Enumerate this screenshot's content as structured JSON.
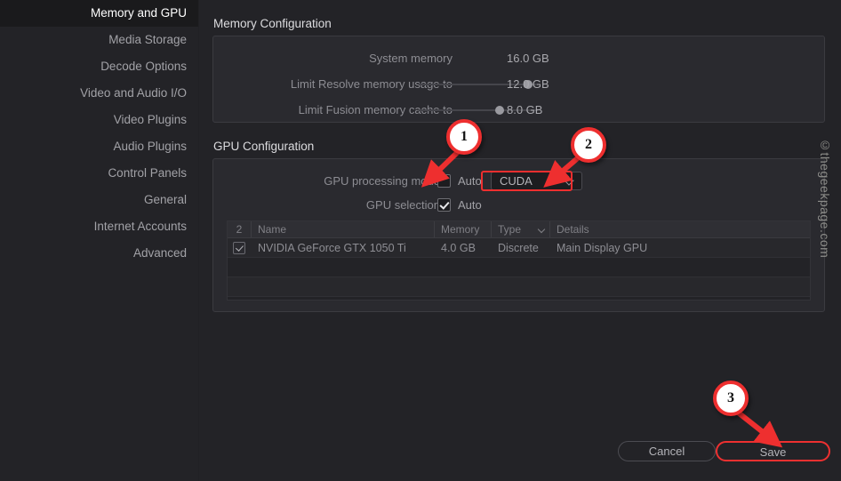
{
  "sidebar": {
    "items": [
      {
        "label": "Memory and GPU",
        "active": true
      },
      {
        "label": "Media Storage",
        "active": false
      },
      {
        "label": "Decode Options",
        "active": false
      },
      {
        "label": "Video and Audio I/O",
        "active": false
      },
      {
        "label": "Video Plugins",
        "active": false
      },
      {
        "label": "Audio Plugins",
        "active": false
      },
      {
        "label": "Control Panels",
        "active": false
      },
      {
        "label": "General",
        "active": false
      },
      {
        "label": "Internet Accounts",
        "active": false
      },
      {
        "label": "Advanced",
        "active": false
      }
    ]
  },
  "memory_configuration": {
    "title": "Memory Configuration",
    "rows": [
      {
        "label": "System memory",
        "value": "16.0 GB",
        "has_slider": false
      },
      {
        "label": "Limit Resolve memory usage to",
        "value": "12.0 GB",
        "has_slider": true,
        "slider_percent": 93
      },
      {
        "label": "Limit Fusion memory cache to",
        "value": "8.0 GB",
        "has_slider": true,
        "slider_percent": 68
      }
    ]
  },
  "gpu_configuration": {
    "title": "GPU Configuration",
    "processing_mode": {
      "label": "GPU processing mode",
      "auto_checked": false,
      "auto_label": "Auto",
      "dropdown_value": "CUDA"
    },
    "gpu_selection": {
      "label": "GPU selection",
      "auto_checked": true,
      "auto_label": "Auto"
    },
    "table": {
      "headers": [
        "2",
        "Name",
        "Memory",
        "Type",
        "Details"
      ],
      "rows": [
        {
          "checked": true,
          "name": "NVIDIA GeForce GTX 1050 Ti",
          "memory": "4.0 GB",
          "type": "Discrete",
          "details": "Main Display GPU"
        }
      ]
    }
  },
  "footer": {
    "cancel_label": "Cancel",
    "save_label": "Save"
  },
  "watermark": {
    "text": "©thegeekpage.com"
  },
  "annotations": {
    "callouts": [
      {
        "number": "1",
        "target": "gpu-processing-mode-auto-checkbox"
      },
      {
        "number": "2",
        "target": "gpu-processing-mode-dropdown"
      },
      {
        "number": "3",
        "target": "save-button"
      }
    ]
  },
  "colors": {
    "accent_red": "#ee2f2f",
    "background": "#232327",
    "panel": "#2a2a2f",
    "sidebar_active": "#1a1a1c"
  }
}
